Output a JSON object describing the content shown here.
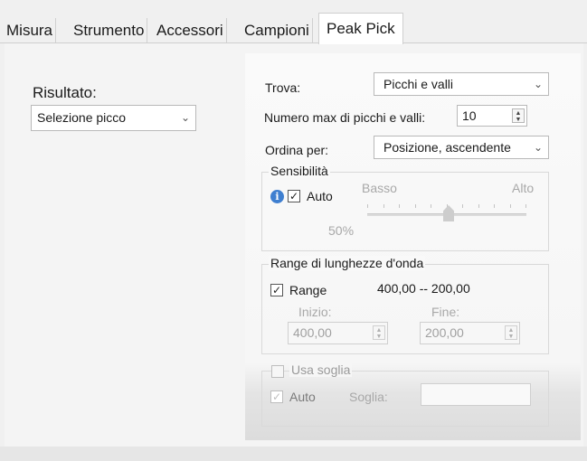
{
  "tabs": [
    {
      "label": "Misura",
      "active": false
    },
    {
      "label": "Strumento",
      "active": false
    },
    {
      "label": "Accessori",
      "active": false
    },
    {
      "label": "Campioni",
      "active": false
    },
    {
      "label": "Peak Pick",
      "active": true
    }
  ],
  "result": {
    "label": "Risultato:",
    "selected": "Selezione picco"
  },
  "find": {
    "label": "Trova:",
    "selected": "Picchi e valli"
  },
  "max_peaks": {
    "label": "Numero max di picchi e valli:",
    "value": "10"
  },
  "sort": {
    "label": "Ordina per:",
    "selected": "Posizione, ascendente"
  },
  "sensitivity": {
    "group_label": "Sensibilità",
    "auto_label": "Auto",
    "auto_checked": true,
    "low_label": "Basso",
    "high_label": "Alto",
    "value_label": "50%",
    "slider_fraction": 0.5
  },
  "wavelength_range": {
    "group_label": "Range di lunghezze d'onda",
    "range_label": "Range",
    "range_checked": true,
    "range_value": "400,00 -- 200,00",
    "start_label": "Inizio:",
    "start_value": "400,00",
    "end_label": "Fine:",
    "end_value": "200,00"
  },
  "threshold": {
    "use_label": "Usa soglia",
    "use_checked": false,
    "auto_label": "Auto",
    "auto_checked": true,
    "threshold_label": "Soglia:",
    "threshold_value": ""
  },
  "icons": {
    "info": "info-icon",
    "dropdown": "chevron-down-icon",
    "spinner": "spin-arrows-icon",
    "check": "checkmark-icon"
  }
}
